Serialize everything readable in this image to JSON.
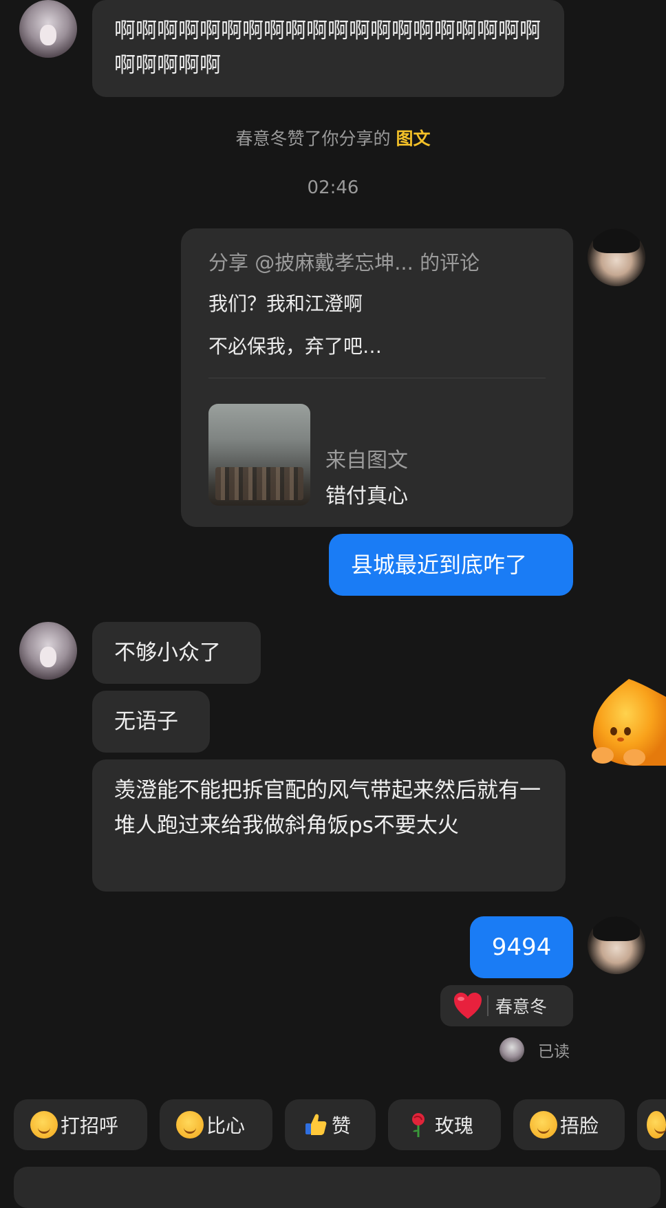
{
  "messages": {
    "incoming_long_1": "啊啊啊啊啊啊啊啊啊啊啊啊啊啊啊啊啊啊啊啊啊啊啊啊啊",
    "system_like_prefix": "春意冬赞了你分享的",
    "system_like_link": "图文",
    "timestamp": "02:46",
    "share_card": {
      "title": "分享 @披麻戴孝忘坤... 的评论",
      "line1": "我们？我和江澄啊",
      "line2": "不必保我，弃了吧…",
      "source_label": "来自图文",
      "source_title": "错付真心"
    },
    "outgoing_1": "县城最近到底咋了",
    "incoming_2": "不够小众了",
    "incoming_3": "无语子",
    "incoming_4": "羡澄能不能把拆官配的风气带起来然后就有一堆人跑过来给我做斜角饭ps不要太火",
    "outgoing_2": "9494",
    "reaction_user": "春意冬",
    "read_status": "已读"
  },
  "quick_replies": [
    {
      "label": "打招呼",
      "icon": "smile-wave-icon"
    },
    {
      "label": "比心",
      "icon": "heart-hands-icon"
    },
    {
      "label": "赞",
      "icon": "thumbs-up-icon"
    },
    {
      "label": "玫瑰",
      "icon": "rose-icon"
    },
    {
      "label": "捂脸",
      "icon": "facepalm-icon"
    }
  ],
  "colors": {
    "background": "#161616",
    "incoming_bubble": "#2c2c2c",
    "outgoing_bubble": "#1a7cf5",
    "highlight": "#f3c028"
  }
}
